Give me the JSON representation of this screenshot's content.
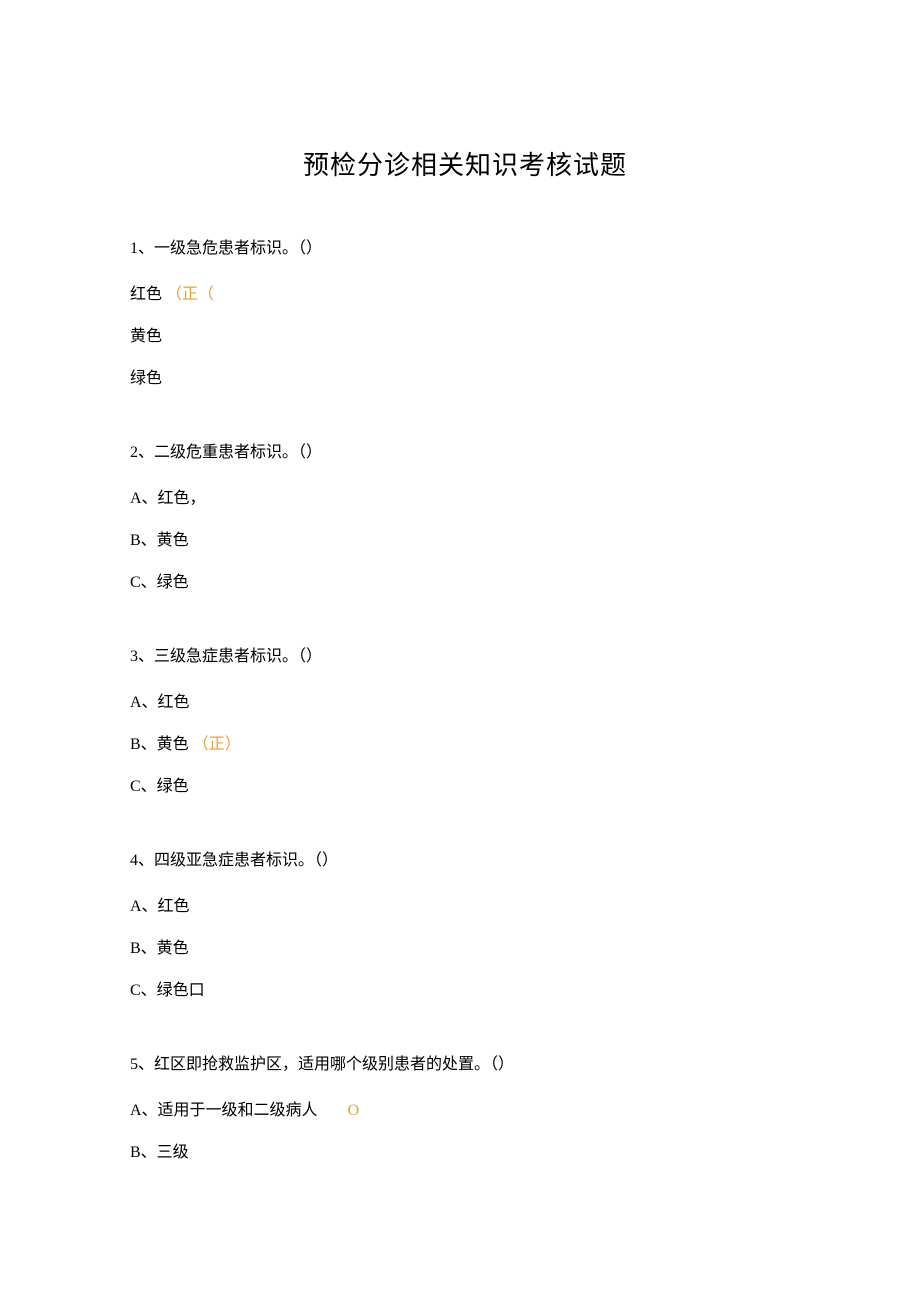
{
  "title": "预检分诊相关知识考核试题",
  "q1": {
    "text": "1、一级急危患者标识。（）",
    "opt_a_text": "红色",
    "opt_a_mark": "（正（",
    "opt_b": "黄色",
    "opt_c": "绿色"
  },
  "q2": {
    "text": "2、二级危重患者标识。（）",
    "opt_a": "A、红色，",
    "opt_b": "B、黄色",
    "opt_c": "C、绿色"
  },
  "q3": {
    "text": "3、三级急症患者标识。（）",
    "opt_a": "A、红色",
    "opt_b_text": "B、黄色",
    "opt_b_mark": "（正）",
    "opt_c": "C、绿色"
  },
  "q4": {
    "text": "4、四级亚急症患者标识。（）",
    "opt_a": "A、红色",
    "opt_b": "B、黄色",
    "opt_c": "C、绿色口"
  },
  "q5": {
    "text": "5、红区即抢救监护区，适用哪个级别患者的处置。（）",
    "opt_a_text": "A、适用于一级和二级病人",
    "opt_a_mark": "O",
    "opt_b": "B、三级"
  }
}
